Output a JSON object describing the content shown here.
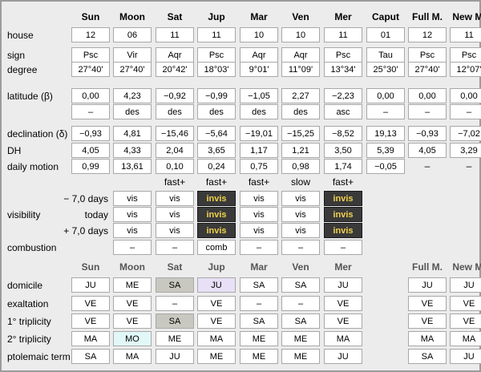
{
  "colors": {
    "panel": "#ececec",
    "box": "#ffffff",
    "invis_bg": "#3a3a3a",
    "invis_fg": "#f2d24a",
    "sa_hl": "#c8c8c0",
    "ju_hl": "#e8e0f6",
    "mo_hl": "#e2f8f8"
  },
  "top_headers": [
    "Sun",
    "Moon",
    "Sat",
    "Jup",
    "Mar",
    "Ven",
    "Mer",
    "Caput",
    "Full M.",
    "New M."
  ],
  "rows_top": [
    {
      "label": "house",
      "values": [
        "12",
        "06",
        "11",
        "11",
        "10",
        "10",
        "11",
        "01",
        "12",
        "11"
      ]
    },
    {
      "label": "sign",
      "values": [
        "Psc",
        "Vir",
        "Aqr",
        "Psc",
        "Aqr",
        "Aqr",
        "Psc",
        "Tau",
        "Psc",
        "Psc"
      ]
    },
    {
      "label": "degree",
      "values": [
        "27°40'",
        "27°40'",
        "20°42'",
        "18°03'",
        "9°01'",
        "11°09'",
        "13°34'",
        "25°30'",
        "27°40'",
        "12°07'"
      ]
    },
    {
      "label": "latitude (β)",
      "values": [
        "0,00",
        "4,23",
        "−0,92",
        "−0,99",
        "−1,05",
        "2,27",
        "−2,23",
        "0,00",
        "0,00",
        "0,00"
      ]
    },
    {
      "label": "",
      "values": [
        "–",
        "des",
        "des",
        "des",
        "des",
        "des",
        "asc",
        "–",
        "–",
        "–"
      ]
    },
    {
      "label": "declination (δ)",
      "values": [
        "−0,93",
        "4,81",
        "−15,46",
        "−5,64",
        "−19,01",
        "−15,25",
        "−8,52",
        "19,13",
        "−0,93",
        "−7,02"
      ]
    },
    {
      "label": "DH",
      "values": [
        "4,05",
        "4,33",
        "2,04",
        "3,65",
        "1,17",
        "1,21",
        "3,50",
        "5,39",
        "4,05",
        "3,29"
      ]
    },
    {
      "label": "daily motion",
      "values": [
        "0,99",
        "13,61",
        "0,10",
        "0,24",
        "0,75",
        "0,98",
        "1,74",
        "−0,05",
        "–",
        "–"
      ]
    }
  ],
  "speed": [
    "fast+",
    "fast+",
    "fast+",
    "slow",
    "fast+"
  ],
  "visibility": {
    "label": "visibility",
    "rows": [
      {
        "label": "− 7,0 days",
        "values": [
          "vis",
          "vis",
          "invis",
          "vis",
          "vis",
          "invis"
        ]
      },
      {
        "label": "today",
        "values": [
          "vis",
          "vis",
          "invis",
          "vis",
          "vis",
          "invis"
        ]
      },
      {
        "label": "+ 7,0 days",
        "values": [
          "vis",
          "vis",
          "invis",
          "vis",
          "vis",
          "invis"
        ]
      }
    ]
  },
  "combustion": {
    "label": "combustion",
    "values": [
      "–",
      "–",
      "comb",
      "–",
      "–",
      "–"
    ]
  },
  "bottom_headers": [
    "Sun",
    "Moon",
    "Sat",
    "Jup",
    "Mar",
    "Ven",
    "Mer",
    "Full M.",
    "New M."
  ],
  "rows_bottom": [
    {
      "label": "domicile",
      "values": [
        "JU",
        "ME",
        "SA",
        "JU",
        "SA",
        "SA",
        "JU",
        "JU",
        "JU"
      ]
    },
    {
      "label": "exaltation",
      "values": [
        "VE",
        "VE",
        "–",
        "VE",
        "–",
        "–",
        "VE",
        "VE",
        "VE"
      ]
    },
    {
      "label": "1° triplicity",
      "values": [
        "VE",
        "VE",
        "SA",
        "VE",
        "SA",
        "SA",
        "VE",
        "VE",
        "VE"
      ]
    },
    {
      "label": "2° triplicity",
      "values": [
        "MA",
        "MO",
        "ME",
        "MA",
        "ME",
        "ME",
        "MA",
        "MA",
        "MA"
      ]
    },
    {
      "label": "ptolemaic term",
      "values": [
        "SA",
        "MA",
        "JU",
        "ME",
        "ME",
        "ME",
        "JU",
        "SA",
        "JU"
      ]
    }
  ]
}
